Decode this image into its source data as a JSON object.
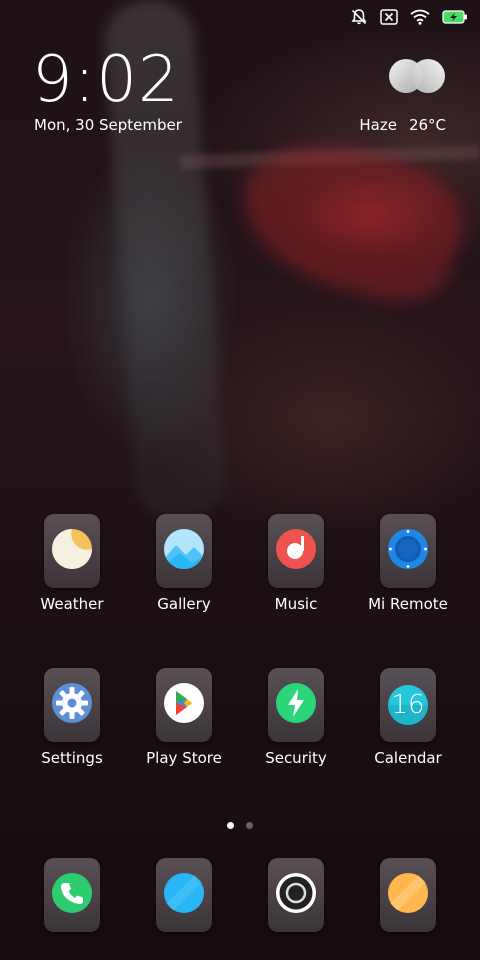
{
  "status_bar": {
    "icons": [
      "mute-notifications-icon",
      "no-sim-icon",
      "wifi-icon",
      "battery-charging-icon"
    ],
    "battery_color": "#4cd964"
  },
  "clock": {
    "time": "9:02",
    "date": "Mon, 30 September"
  },
  "weather": {
    "condition": "Haze",
    "temperature": "26°C",
    "icon": "haze-cloud-icon"
  },
  "apps": [
    {
      "label": "Weather",
      "icon": "weather-moon-icon",
      "colors": [
        "#f5f0e0",
        "#f4c25a"
      ]
    },
    {
      "label": "Gallery",
      "icon": "gallery-mountains-icon",
      "colors": [
        "#4fc3f7",
        "#b3e5fc"
      ]
    },
    {
      "label": "Music",
      "icon": "music-note-icon",
      "colors": [
        "#ef5350",
        "#ffffff"
      ]
    },
    {
      "label": "Mi Remote",
      "icon": "remote-circle-icon",
      "colors": [
        "#1e88e5",
        "#0d47a1"
      ]
    },
    {
      "label": "Settings",
      "icon": "settings-gear-icon",
      "colors": [
        "#5c8fd6",
        "#ffffff"
      ]
    },
    {
      "label": "Play Store",
      "icon": "play-store-icon",
      "colors": [
        "#34a853",
        "#fbbc05",
        "#ea4335",
        "#4285f4"
      ]
    },
    {
      "label": "Security",
      "icon": "security-bolt-icon",
      "colors": [
        "#2bd67b",
        "#ffffff"
      ]
    },
    {
      "label": "Calendar",
      "icon": "calendar-16-icon",
      "colors": [
        "#26c6da",
        "#ffffff"
      ],
      "day": "16"
    }
  ],
  "page_indicator": {
    "count": 2,
    "active": 0
  },
  "dock": [
    {
      "icon": "phone-icon",
      "colors": [
        "#2ecc71",
        "#ffffff"
      ]
    },
    {
      "icon": "messages-icon",
      "colors": [
        "#29b6f6",
        "#4fc3f7"
      ]
    },
    {
      "icon": "camera-icon",
      "colors": [
        "#ffffff",
        "#222222"
      ]
    },
    {
      "icon": "browser-icon",
      "colors": [
        "#ffb74d",
        "#ffcc80"
      ]
    }
  ]
}
